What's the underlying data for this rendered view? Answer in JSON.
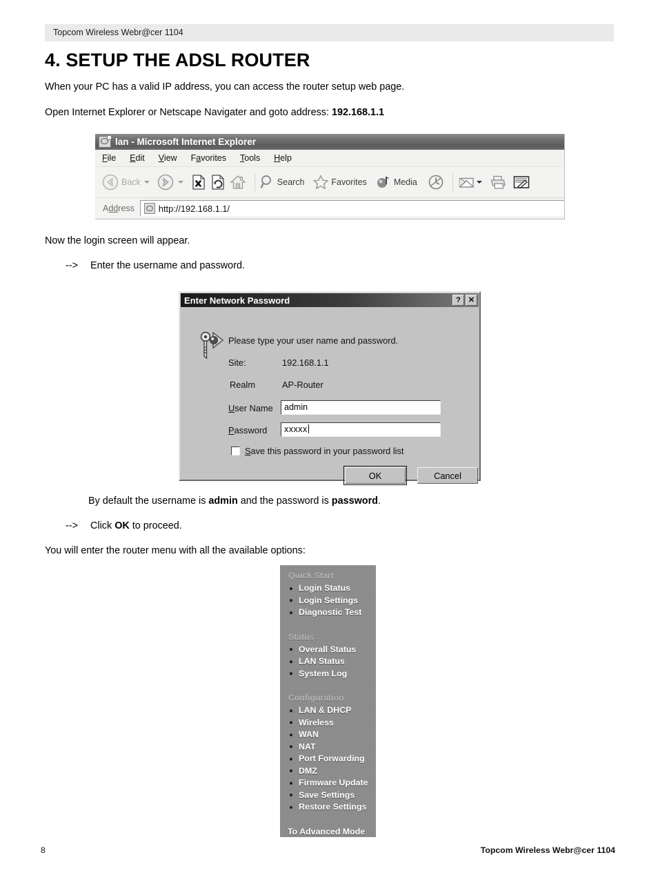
{
  "header": {
    "band_text": "Topcom Wireless Webr@cer 1104"
  },
  "page_title": "4. SETUP THE ADSL ROUTER",
  "paragraphs": {
    "p1": "When your PC has a valid IP address, you can access the router setup web page.",
    "p2_prefix": "Open Internet Explorer or Netscape Navigater and goto address: ",
    "p2_bold": "192.168.1.1",
    "p3": "Now the login screen will appear.",
    "p4_arrow": "-->",
    "p4_text": "Enter the username and password.",
    "p5_a": "By default the username is ",
    "p5_bold1": "admin",
    "p5_b": " and the password is ",
    "p5_bold2": "password",
    "p5_c": ".",
    "p6_arrow": "-->",
    "p6_a": "Click ",
    "p6_bold": "OK",
    "p6_b": " to proceed.",
    "p7": "You will enter the router menu with all the available options:"
  },
  "browser": {
    "title": "lan - Microsoft Internet Explorer",
    "menu": [
      {
        "pre": "",
        "key": "F",
        "post": "ile"
      },
      {
        "pre": "",
        "key": "E",
        "post": "dit"
      },
      {
        "pre": "",
        "key": "V",
        "post": "iew"
      },
      {
        "pre": "F",
        "key": "a",
        "post": "vorites"
      },
      {
        "pre": "",
        "key": "T",
        "post": "ools"
      },
      {
        "pre": "",
        "key": "H",
        "post": "elp"
      }
    ],
    "toolbar": {
      "back_label": "Back",
      "search_label": "Search",
      "favorites_label": "Favorites",
      "media_label": "Media"
    },
    "address": {
      "label_pre": "A",
      "label_key": "dd",
      "label_post": "ress",
      "url": "http://192.168.1.1/"
    }
  },
  "dialog": {
    "title": "Enter Network Password",
    "help_button": "?",
    "close_button": "✕",
    "prompt": "Please type your user name and password.",
    "site_label": "Site:",
    "site_value": "192.168.1.1",
    "realm_label": "Realm",
    "realm_value": "AP-Router",
    "username_label_pre": "U",
    "username_label_post": "ser Name",
    "username_value": "admin",
    "password_label_pre": "P",
    "password_label_post": "assword",
    "password_value": "xxxxx",
    "save_check_pre": "S",
    "save_check_post": "ave this password in your password list",
    "ok_label": "OK",
    "cancel_label": "Cancel"
  },
  "router_menu": {
    "sections": [
      {
        "title": "Quick Start",
        "items": [
          "Login Status",
          "Login Settings",
          "Diagnostic Test"
        ]
      },
      {
        "title": "Status",
        "items": [
          "Overall Status",
          "LAN Status",
          "System Log"
        ]
      },
      {
        "title": "Configuration",
        "items": [
          "LAN & DHCP",
          "Wireless",
          "WAN",
          "NAT",
          "Port Forwarding",
          "DMZ",
          "Firmware Update",
          "Save Settings",
          "Restore Settings"
        ]
      }
    ],
    "advanced_link": "To Advanced Mode"
  },
  "footer": {
    "page_number": "8",
    "doc_title": "Topcom Wireless Webr@cer 1104"
  },
  "colors": {
    "header_band": "#eaeaea",
    "dialog_face": "#c3c3c3",
    "menu_background": "#8d8d8d",
    "menu_section_text": "#b6b6b6",
    "menu_item_text": "#ffffff"
  }
}
